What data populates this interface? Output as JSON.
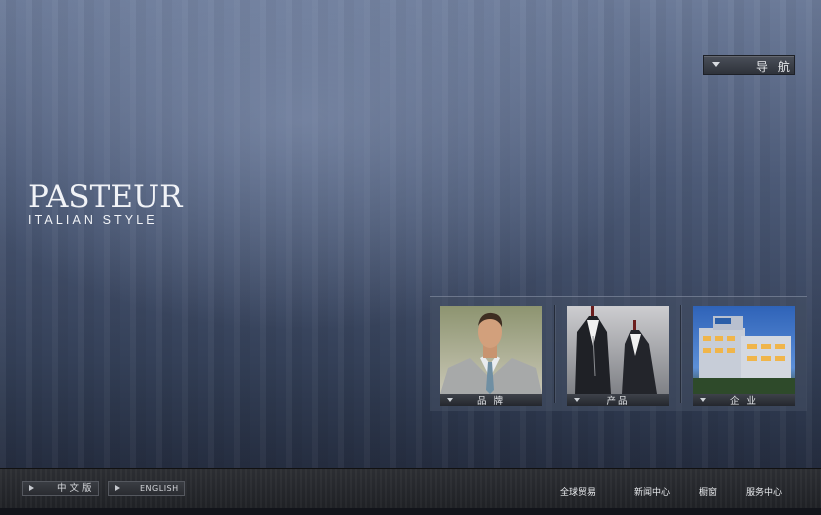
{
  "logo": {
    "main": "PASTEUR",
    "sub": "ITALIAN STYLE"
  },
  "nav": {
    "label": "导 航",
    "icon": "triangle-down-icon"
  },
  "cards": [
    {
      "label": "品 牌",
      "image": "brand-photo"
    },
    {
      "label": "产品",
      "image": "product-photo"
    },
    {
      "label": "企 业",
      "image": "company-photo"
    }
  ],
  "footer": {
    "lang_cn": "中 文 版",
    "lang_en": "ENGLISH",
    "links": [
      "全球贸易",
      "新闻中心",
      "橱窗",
      "服务中心"
    ]
  },
  "colors": {
    "background": "#4c5a77",
    "footer": "#26282d",
    "text": "#e9ebee"
  }
}
